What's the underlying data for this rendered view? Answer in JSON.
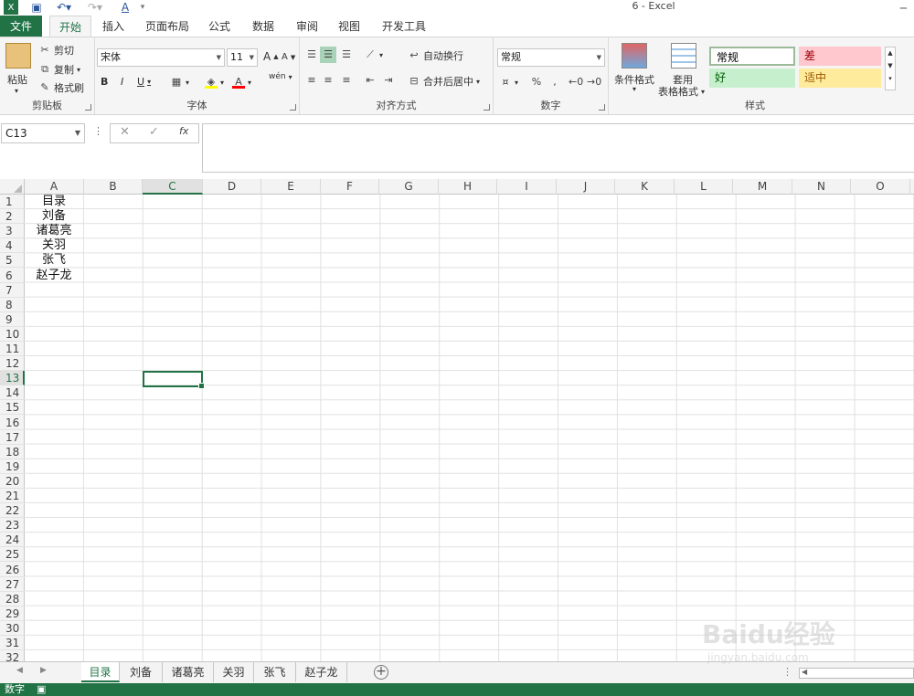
{
  "titlebar": {
    "app_title": "6 - Excel",
    "font_color_glyph": "A"
  },
  "ribbon_tabs": [
    "文件",
    "开始",
    "插入",
    "页面布局",
    "公式",
    "数据",
    "审阅",
    "视图",
    "开发工具"
  ],
  "clipboard": {
    "paste": "粘贴",
    "cut": "剪切",
    "copy": "复制",
    "format_painter": "格式刷",
    "label": "剪贴板"
  },
  "font": {
    "name": "宋体",
    "size": "11",
    "bold": "B",
    "italic": "I",
    "underline": "U",
    "wen": "wén",
    "label": "字体",
    "grow": "A",
    "shrink": "A",
    "font_color": "A"
  },
  "alignment": {
    "wrap": "自动换行",
    "merge": "合并后居中",
    "label": "对齐方式"
  },
  "number": {
    "format": "常规",
    "label": "数字"
  },
  "styles": {
    "conditional": "条件格式",
    "table_line1": "套用",
    "table_line2": "表格格式",
    "normal": "常规",
    "bad": "差",
    "good": "好",
    "neutral": "适中",
    "label": "样式",
    "colors": {
      "bad_bg": "#ffc7ce",
      "bad_fg": "#9c0006",
      "good_bg": "#c6efce",
      "good_fg": "#006100",
      "neutral_bg": "#ffeb9c",
      "neutral_fg": "#9c5700"
    }
  },
  "formula_bar": {
    "name_box": "C13",
    "cancel": "✕",
    "enter": "✓",
    "fx": "fx",
    "formula": ""
  },
  "columns": [
    "A",
    "B",
    "C",
    "D",
    "E",
    "F",
    "G",
    "H",
    "I",
    "J",
    "K",
    "L",
    "M",
    "N",
    "O"
  ],
  "selected_column": "C",
  "rows": [
    "1",
    "2",
    "3",
    "4",
    "5",
    "6",
    "7",
    "8",
    "9",
    "10",
    "11",
    "12",
    "13",
    "14",
    "15",
    "16",
    "17",
    "18",
    "19",
    "20",
    "21",
    "22",
    "23",
    "24",
    "25",
    "26",
    "27",
    "28",
    "29",
    "30",
    "31",
    "32"
  ],
  "selected_row": "13",
  "cells_A": [
    "目录",
    "刘备",
    "诸葛亮",
    "关羽",
    "张飞",
    "赵子龙"
  ],
  "sheets": [
    "目录",
    "刘备",
    "诸葛亮",
    "关羽",
    "张飞",
    "赵子龙"
  ],
  "active_sheet": "目录",
  "status": {
    "mode": "数字"
  },
  "watermark": {
    "brand": "Baidu经验",
    "url": "jingyan.baidu.com"
  },
  "theme": {
    "accent": "#217346"
  }
}
